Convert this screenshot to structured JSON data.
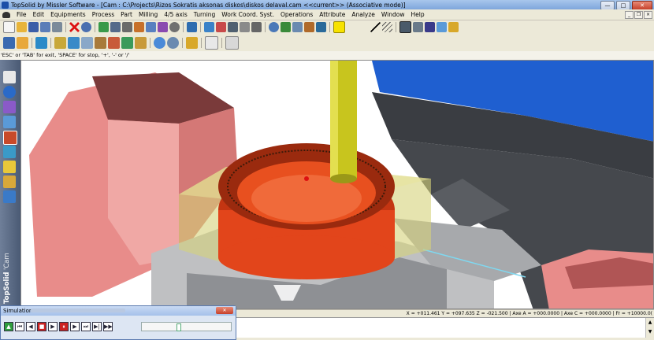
{
  "window": {
    "title": "TopSolid by Missler Software - [Cam : C:\\Projects\\Rizos Sokratis aksonas diskos\\diskos delaval.cam <<current>> (Associative mode)]",
    "controls": {
      "minimize": "—",
      "maximize": "□",
      "close": "✕"
    }
  },
  "menu": {
    "items": [
      "File",
      "Edit",
      "Equipments",
      "Process",
      "Part",
      "Milling",
      "4/5 axis",
      "Turning",
      "Work Coord. Syst.",
      "Operations",
      "Attribute",
      "Analyze",
      "Window",
      "Help"
    ],
    "doc_controls": {
      "minimize": "_",
      "restore": "❐",
      "close": "×"
    }
  },
  "hint": "'ESC' or 'TAB' for exit, 'SPACE' for stop, '+', '-' or '/'",
  "brand": {
    "name": "TopSolid",
    "module": "'Cam"
  },
  "status": {
    "coords": "X = +011.461  Y = +097.635  Z = -021.500  | Axe A = +000.0000 | Axe C = +000.0000 | Fr = +10000.0("
  },
  "simulation": {
    "title": "Simulation",
    "close": "✕",
    "buttons": [
      "▲",
      "⏮",
      "◀",
      "■",
      "▶",
      "⏸",
      "▶",
      "⏭",
      "▶|",
      "▶▶"
    ]
  },
  "colors": {
    "viewport_bg": "#ffffff",
    "fixture_pink": "#e88c8a",
    "workpiece_orange": "#e2451b",
    "stock_yellow": "#d6d27a",
    "tool_yellow": "#c8c51e",
    "machine_blue": "#1f5fd0"
  }
}
